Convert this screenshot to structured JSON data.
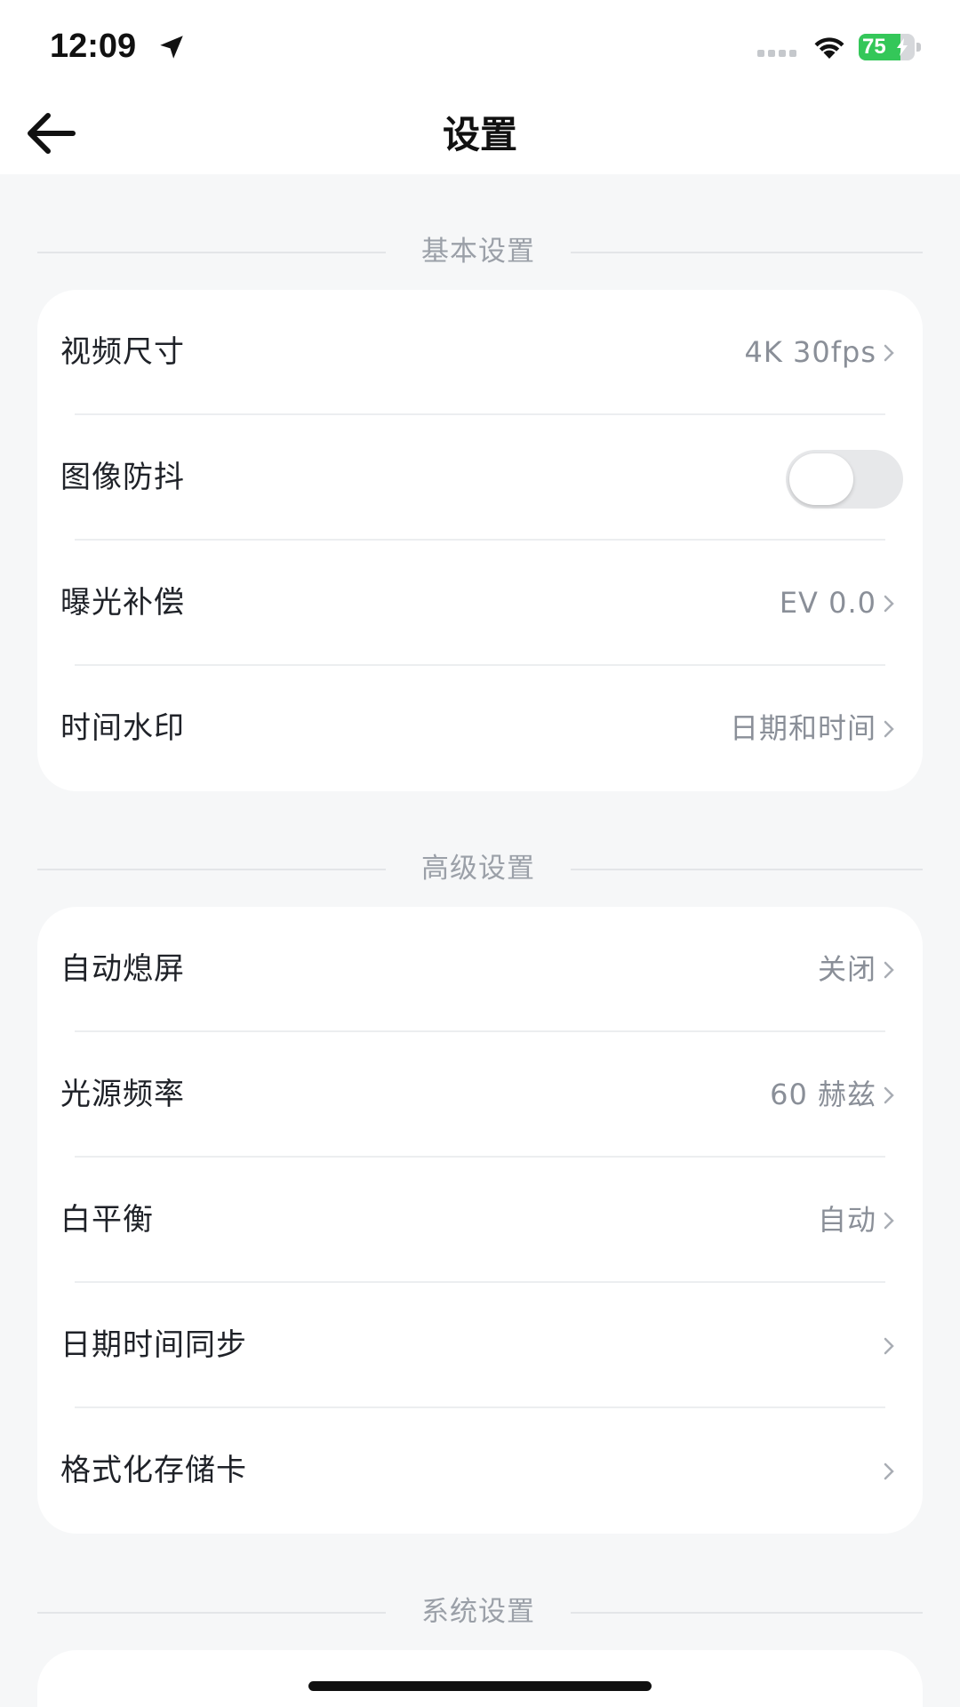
{
  "status_bar": {
    "time": "12:09",
    "battery_percent": 75,
    "battery_label": "75",
    "battery_color": "#34c759"
  },
  "nav": {
    "title": "设置",
    "back_icon": "arrow-left-icon"
  },
  "sections": {
    "basic": {
      "header": "基本设置",
      "items": [
        {
          "label": "视频尺寸",
          "value": "4K 30fps"
        },
        {
          "label": "图像防抖",
          "toggle_on": false
        },
        {
          "label": "曝光补偿",
          "value": "EV 0.0"
        },
        {
          "label": "时间水印",
          "value": "日期和时间"
        }
      ]
    },
    "advanced": {
      "header": "高级设置",
      "items": [
        {
          "label": "自动熄屏",
          "value": "关闭"
        },
        {
          "label": "光源频率",
          "value": "60 赫兹"
        },
        {
          "label": "白平衡",
          "value": "自动"
        },
        {
          "label": "日期时间同步",
          "value": ""
        },
        {
          "label": "格式化存储卡",
          "value": ""
        }
      ]
    },
    "system": {
      "header": "系统设置"
    }
  },
  "colors": {
    "background": "#f6f7f8",
    "card": "#ffffff",
    "secondary_text": "#8a8f98"
  }
}
